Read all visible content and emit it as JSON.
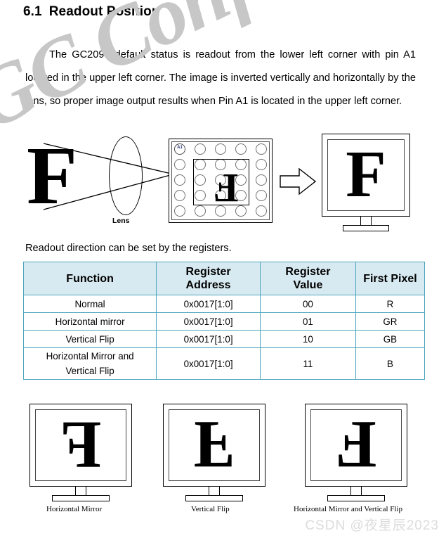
{
  "heading": {
    "number": "6.1",
    "title": "Readout Position"
  },
  "body": {
    "paragraph": "The GC2093 default status is readout from the lower left corner with pin A1 located in the upper left corner. The image is inverted vertically and horizontally by the lens, so proper image output results when Pin A1 is located in the upper left corner.",
    "table_intro": "Readout direction can be set by the registers."
  },
  "diagram": {
    "object_letter": "F",
    "lens_label": "Lens",
    "sensor_ball_label": "A1",
    "sensor_letter": "F",
    "arrow_icon": "right-block-arrow",
    "monitor_letter": "F"
  },
  "table": {
    "headers": [
      "Function",
      "Register Address",
      "Register Value",
      "First Pixel"
    ],
    "header_lines": [
      [
        "Function"
      ],
      [
        "Register",
        "Address"
      ],
      [
        "Register",
        "Value"
      ],
      [
        "First Pixel"
      ]
    ],
    "rows": [
      {
        "function": "Normal",
        "address": "0x0017[1:0]",
        "value": "00",
        "pixel": "R"
      },
      {
        "function": "Horizontal mirror",
        "address": "0x0017[1:0]",
        "value": "01",
        "pixel": "GR"
      },
      {
        "function": "Vertical Flip",
        "address": "0x0017[1:0]",
        "value": "10",
        "pixel": "GB"
      },
      {
        "function": "Horizontal Mirror and Vertical Flip",
        "function_line1": "Horizontal Mirror and",
        "function_line2": "Vertical Flip",
        "address": "0x0017[1:0]",
        "value": "11",
        "pixel": "B"
      }
    ]
  },
  "examples": [
    {
      "caption": "Horizontal Mirror",
      "letter": "F"
    },
    {
      "caption": "Vertical Flip",
      "letter": "F"
    },
    {
      "caption": "Horizontal Mirror and Vertical Flip",
      "letter": "F"
    }
  ],
  "watermarks": {
    "diagonal": "GC Confidential",
    "footer": "CSDN @夜星辰2023"
  },
  "colors": {
    "table_header_bg": "#d8eaf1",
    "table_border": "#4ca6bd",
    "watermark_gray": "#c7c7c7",
    "a1_label": "#1a2a6c"
  }
}
